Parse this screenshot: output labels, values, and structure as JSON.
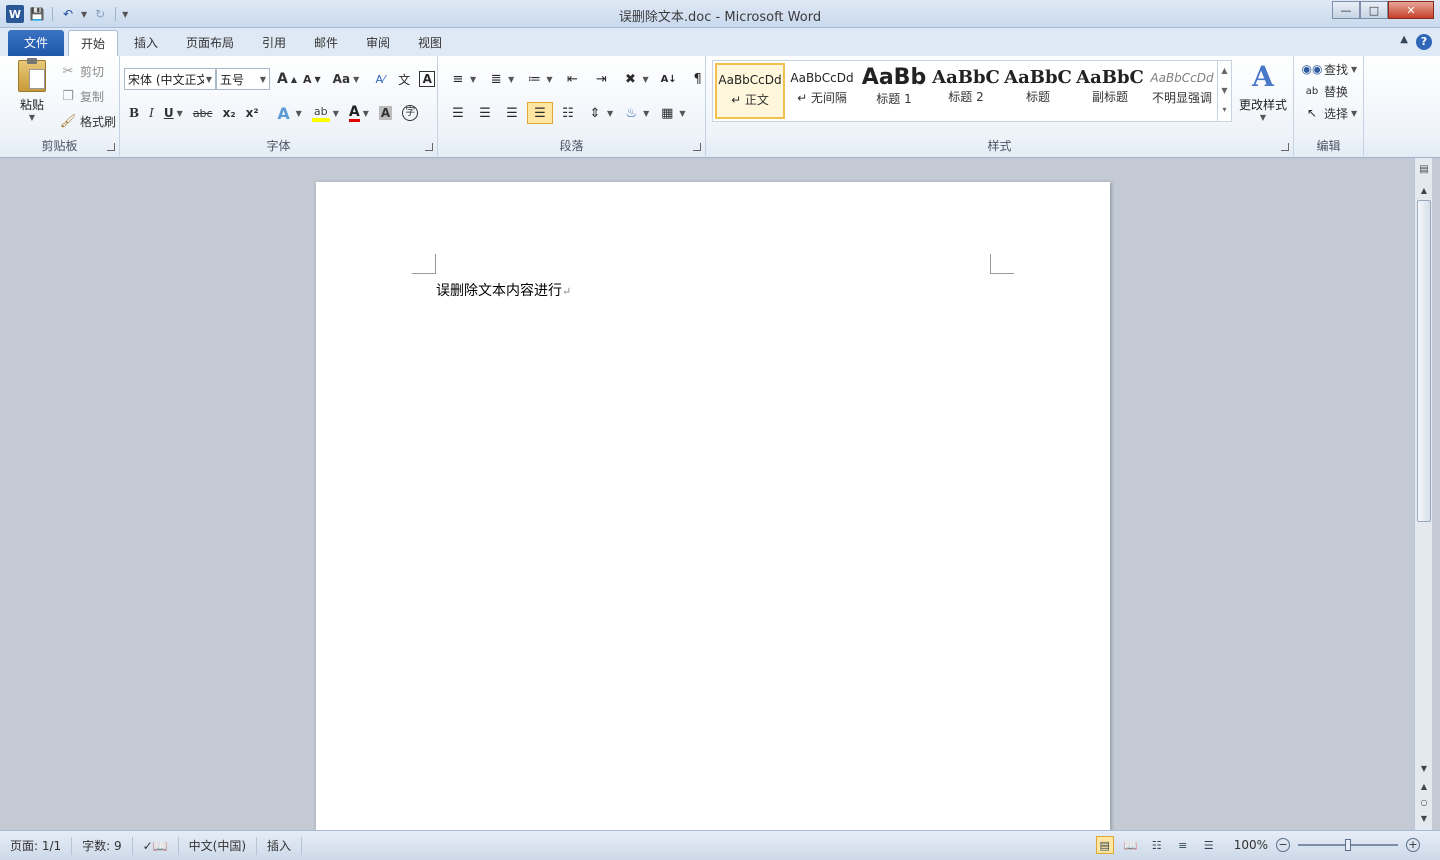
{
  "titlebar": {
    "title": "误删除文本.doc - Microsoft Word",
    "app_icon": "W",
    "qat": [
      "save-icon",
      "undo-icon",
      "redo-icon",
      "customize-icon"
    ]
  },
  "tabs": [
    {
      "label": "文件"
    },
    {
      "label": "开始"
    },
    {
      "label": "插入"
    },
    {
      "label": "页面布局"
    },
    {
      "label": "引用"
    },
    {
      "label": "邮件"
    },
    {
      "label": "审阅"
    },
    {
      "label": "视图"
    }
  ],
  "clipboard": {
    "group_label": "剪贴板",
    "paste": "粘贴",
    "cut": "剪切",
    "copy": "复制",
    "format_painter": "格式刷"
  },
  "font": {
    "group_label": "字体",
    "font_name": "宋体 (中文正文",
    "font_size": "五号",
    "bold": "B",
    "italic": "I",
    "underline": "U",
    "strikethrough": "abc",
    "subscript": "x₂",
    "superscript": "x²",
    "grow": "A",
    "shrink": "A",
    "change_case": "Aa",
    "font_color": "A",
    "char_shading": "A",
    "enclose": "字"
  },
  "paragraph": {
    "group_label": "段落"
  },
  "styles": {
    "group_label": "样式",
    "items": [
      {
        "sample": "AaBbCcDd",
        "name": "↵ 正文"
      },
      {
        "sample": "AaBbCcDd",
        "name": "↵ 无间隔"
      },
      {
        "sample": "AaBb",
        "name": "标题 1"
      },
      {
        "sample": "AaBbC",
        "name": "标题 2"
      },
      {
        "sample": "AaBbC",
        "name": "标题"
      },
      {
        "sample": "AaBbC",
        "name": "副标题"
      },
      {
        "sample": "AaBbCcDd",
        "name": "不明显强调"
      }
    ],
    "change_styles": "更改样式"
  },
  "editing": {
    "group_label": "编辑",
    "find": "查找",
    "replace": "替换",
    "select": "选择"
  },
  "document": {
    "text": "误删除文本内容进行",
    "para_mark": "↵"
  },
  "statusbar": {
    "page": "页面: 1/1",
    "words": "字数: 9",
    "language": "中文(中国)",
    "mode": "插入",
    "zoom": "100%",
    "zoom_fraction": 0.5
  }
}
